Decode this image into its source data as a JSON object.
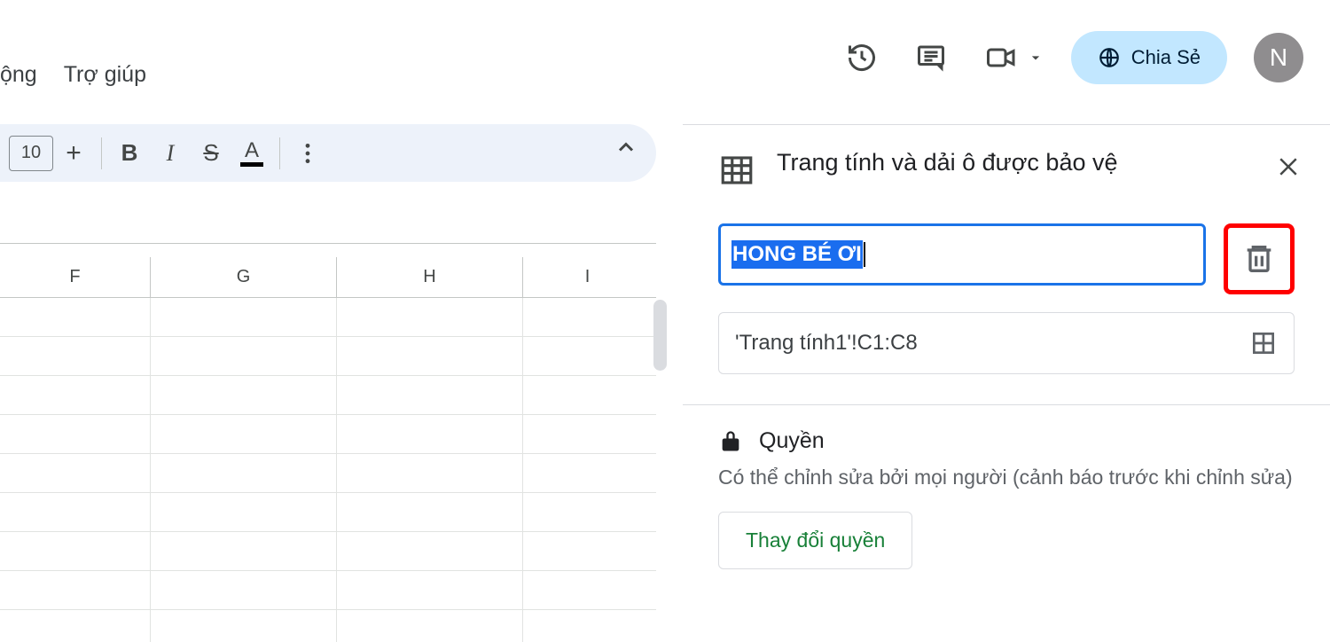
{
  "menu": {
    "item1": "ộng",
    "item2": "Trợ giúp"
  },
  "topright": {
    "share_label": "Chia Sẻ",
    "avatar_letter": "N"
  },
  "toolbar": {
    "font_size": "10"
  },
  "columns": {
    "f": "F",
    "g": "G",
    "h": "H",
    "i": "I"
  },
  "sidepanel": {
    "title": "Trang tính và dải ô được bảo vệ",
    "description_value": "HONG BÉ ƠI",
    "range_value": "'Trang tính1'!C1:C8",
    "perm_heading": "Quyền",
    "perm_desc": "Có thể chỉnh sửa bởi mọi người (cảnh báo trước khi chỉnh sửa)",
    "change_perm_btn": "Thay đổi quyền"
  }
}
